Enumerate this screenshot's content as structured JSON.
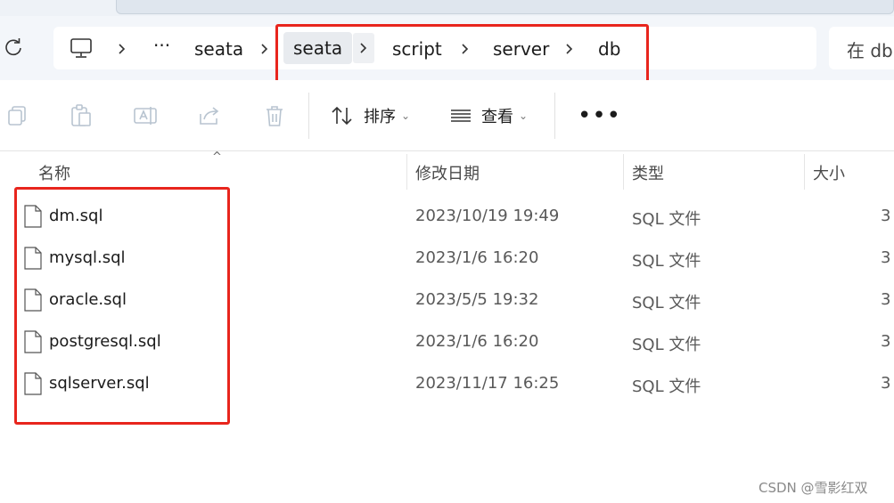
{
  "address": {
    "crumbs": [
      "seata",
      "seata",
      "script",
      "server",
      "db"
    ],
    "ellipsis": "···",
    "search_placeholder": "在 db"
  },
  "toolbar": {
    "sort_label": "排序",
    "view_label": "查看",
    "more_label": "•••"
  },
  "columns": {
    "name": "名称",
    "modified": "修改日期",
    "type": "类型",
    "size": "大小"
  },
  "files": [
    {
      "name": "dm.sql",
      "modified": "2023/10/19 19:49",
      "type": "SQL 文件",
      "size": "3"
    },
    {
      "name": "mysql.sql",
      "modified": "2023/1/6 16:20",
      "type": "SQL 文件",
      "size": "3"
    },
    {
      "name": "oracle.sql",
      "modified": "2023/5/5 19:32",
      "type": "SQL 文件",
      "size": "3"
    },
    {
      "name": "postgresql.sql",
      "modified": "2023/1/6 16:20",
      "type": "SQL 文件",
      "size": "3"
    },
    {
      "name": "sqlserver.sql",
      "modified": "2023/11/17 16:25",
      "type": "SQL 文件",
      "size": "3"
    }
  ],
  "watermark": "CSDN @雪影红双",
  "colors": {
    "highlight_box": "#e8251d"
  }
}
